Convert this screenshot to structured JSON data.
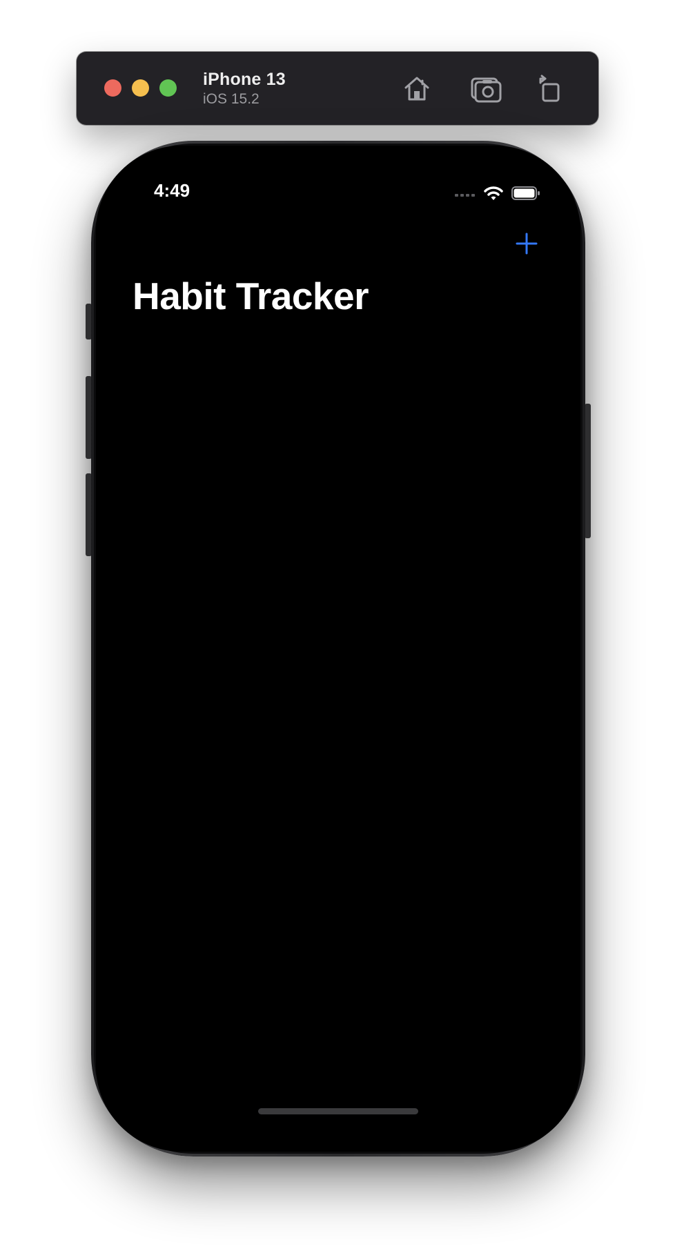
{
  "simulator": {
    "device_name": "iPhone 13",
    "os_version": "iOS 15.2",
    "toolbar_icons": [
      "home-icon",
      "screenshot-icon",
      "rotate-icon"
    ]
  },
  "status_bar": {
    "time": "4:49",
    "icons": [
      "cellular-signal-icon",
      "wifi-icon",
      "battery-icon"
    ]
  },
  "navigation": {
    "title": "Habit Tracker",
    "add_icon": "plus-icon"
  },
  "colors": {
    "accent": "#3478f6",
    "background": "#000000",
    "toolbar": "#232226"
  }
}
